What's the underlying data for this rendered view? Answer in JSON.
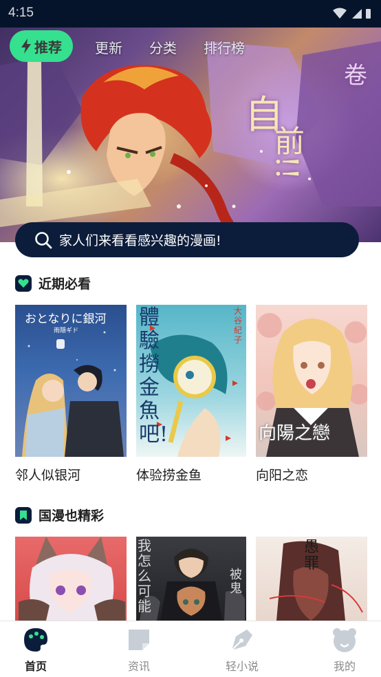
{
  "status": {
    "time": "4:15"
  },
  "nav": {
    "tabs": [
      {
        "label": "推荐",
        "active": true
      },
      {
        "label": "更新"
      },
      {
        "label": "分类"
      },
      {
        "label": "排行榜"
      }
    ]
  },
  "banner": {
    "art_text": "前!!",
    "art_text_top": "自",
    "art_text_right": "卷"
  },
  "search": {
    "placeholder": "家人们来看看感兴趣的漫画!"
  },
  "sections": [
    {
      "title": "近期必看",
      "icon": "heart-icon",
      "items": [
        {
          "title": "邻人似银河",
          "cover_text": "おとなりに銀河",
          "cover_sub": "雨隠ギド"
        },
        {
          "title": "体验捞金鱼",
          "cover_text": "體驗撈金魚吧!",
          "cover_sub": "大谷紀子"
        },
        {
          "title": "向阳之恋",
          "cover_text": "向陽之戀"
        }
      ]
    },
    {
      "title": "国漫也精彩",
      "icon": "bookmark-icon",
      "items": [
        {
          "title": "",
          "cover_text": ""
        },
        {
          "title": "",
          "cover_text": "我怎么可能",
          "cover_text_right": "被鬼"
        },
        {
          "title": "",
          "cover_text": "愚罪"
        }
      ]
    }
  ],
  "bottom_tabs": [
    {
      "label": "首页",
      "icon": "home-palette-icon",
      "active": true
    },
    {
      "label": "资讯",
      "icon": "note-icon"
    },
    {
      "label": "轻小说",
      "icon": "pen-nib-icon"
    },
    {
      "label": "我的",
      "icon": "bear-face-icon"
    }
  ],
  "colors": {
    "accent": "#35e08e",
    "navy": "#0c1d3b",
    "inactive": "#c8ced6"
  }
}
